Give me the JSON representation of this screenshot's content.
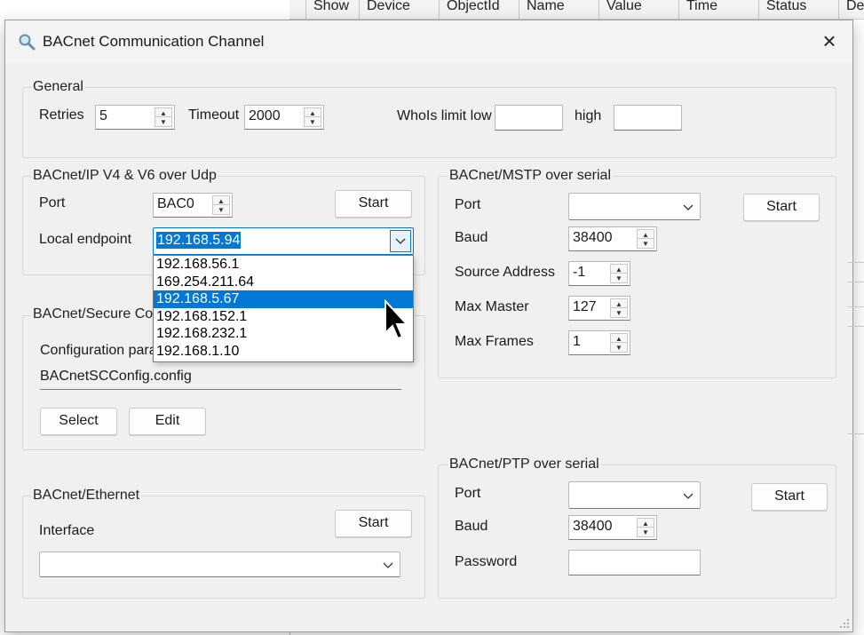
{
  "background_grid": {
    "columns": [
      "Show",
      "Device",
      "ObjectId",
      "Name",
      "Value",
      "Time",
      "Status",
      "De"
    ]
  },
  "window": {
    "title": "BACnet Communication Channel",
    "icon": "magnifier-icon",
    "close": "×"
  },
  "general": {
    "title": "General",
    "retries_label": "Retries",
    "retries_value": "5",
    "timeout_label": "Timeout",
    "timeout_value": "2000",
    "whois_low_label": "WhoIs limit low",
    "whois_low_value": "",
    "whois_high_label": "high",
    "whois_high_value": ""
  },
  "bacnet_ip": {
    "title": "BACnet/IP V4 & V6 over Udp",
    "port_label": "Port",
    "port_value": "BAC0",
    "start_label": "Start",
    "local_endpoint_label": "Local endpoint",
    "local_endpoint_value": "192.168.5.94",
    "endpoint_options": [
      "192.168.56.1",
      "169.254.211.64",
      "192.168.5.67",
      "192.168.152.1",
      "192.168.232.1",
      "192.168.1.10"
    ],
    "highlighted_option": "192.168.5.67"
  },
  "bacnet_sc": {
    "title": "BACnet/Secure Co",
    "config_label": "Configuration para",
    "config_value": "BACnetSCConfig.config",
    "select_label": "Select",
    "edit_label": "Edit"
  },
  "bacnet_ethernet": {
    "title": "BACnet/Ethernet",
    "interface_label": "Interface",
    "interface_value": "",
    "start_label": "Start"
  },
  "bacnet_mstp": {
    "title": "BACnet/MSTP over serial",
    "port_label": "Port",
    "port_value": "",
    "start_label": "Start",
    "baud_label": "Baud",
    "baud_value": "38400",
    "source_label": "Source Address",
    "source_value": "-1",
    "max_master_label": "Max Master",
    "max_master_value": "127",
    "max_frames_label": "Max Frames",
    "max_frames_value": "1"
  },
  "bacnet_ptp": {
    "title": "BACnet/PTP over serial",
    "port_label": "Port",
    "port_value": "",
    "start_label": "Start",
    "baud_label": "Baud",
    "baud_value": "38400",
    "password_label": "Password",
    "password_value": ""
  },
  "colors": {
    "dialog_bg": "#f0f0f0",
    "selection": "#0078d7"
  }
}
